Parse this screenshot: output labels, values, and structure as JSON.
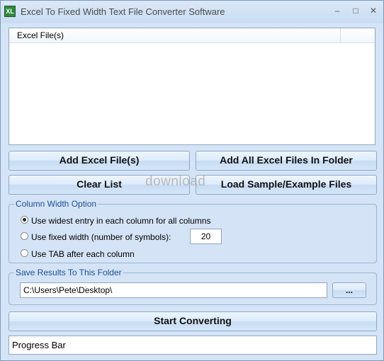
{
  "window": {
    "title": "Excel To Fixed Width Text File Converter Software",
    "app_icon_glyph": "XL",
    "controls": {
      "minimize": "–",
      "maximize": "□",
      "close": "✕"
    }
  },
  "file_list": {
    "column_header": "Excel File(s)",
    "rows": []
  },
  "buttons": {
    "add_files": "Add Excel File(s)",
    "add_all_in_folder": "Add All Excel Files In Folder",
    "clear_list": "Clear List",
    "load_sample": "Load Sample/Example Files",
    "browse": "...",
    "start": "Start Converting"
  },
  "column_width": {
    "title": "Column Width Option",
    "options": [
      {
        "label": "Use widest entry in each column for all columns",
        "checked": true
      },
      {
        "label": "Use fixed width (number of symbols):",
        "checked": false
      },
      {
        "label": "Use TAB after each column",
        "checked": false
      }
    ],
    "fixed_width_value": "20"
  },
  "save_folder": {
    "title": "Save Results To This Folder",
    "path": "C:\\Users\\Pete\\Desktop\\"
  },
  "progress": {
    "label": "Progress Bar"
  },
  "watermark": "download"
}
